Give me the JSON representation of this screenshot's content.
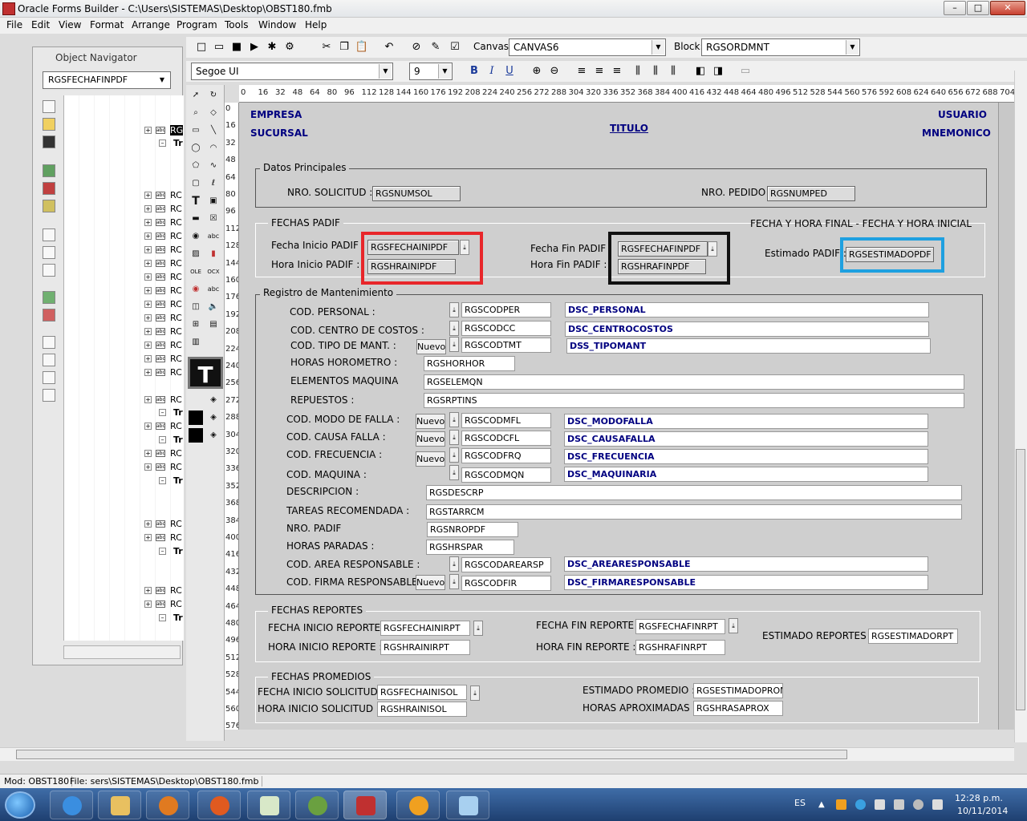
{
  "window": {
    "title": "Oracle Forms Builder - C:\\Users\\SISTEMAS\\Desktop\\OBST180.fmb",
    "min": "–",
    "max": "□",
    "close": "✕"
  },
  "menu": [
    "File",
    "Edit",
    "View",
    "Format",
    "Arrange",
    "Program",
    "Tools",
    "Window",
    "Help"
  ],
  "navigator": {
    "title": "Object Navigator",
    "selected": "RGSFECHAFINPDF",
    "items": [
      "RG",
      "Tr",
      "RC",
      "RC",
      "RC",
      "RC",
      "RC",
      "RC",
      "RC",
      "RC",
      "RC",
      "RC",
      "RC",
      "RC",
      "RC",
      "RC",
      "RC",
      "Tr",
      "RC",
      "Tr",
      "RC",
      "RC",
      "Tr",
      "RC",
      "RC",
      "Tr",
      "RC",
      "RC",
      "Tr"
    ]
  },
  "toolbar": {
    "canvas_label": "Canvas:",
    "canvas_value": "CANVAS6",
    "block_label": "Block:",
    "block_value": "RGSORDMNT",
    "font_value": "Segoe UI",
    "size_value": "9",
    "bold": "B",
    "italic": "I",
    "underline": "U"
  },
  "ruler": {
    "h": [
      "0",
      "16",
      "32",
      "48",
      "64",
      "80",
      "96",
      "112",
      "128",
      "144",
      "160",
      "176",
      "192",
      "208",
      "224",
      "240",
      "256",
      "272",
      "288",
      "304",
      "320",
      "336",
      "352",
      "368",
      "384",
      "400",
      "416",
      "432",
      "448",
      "464",
      "480",
      "496",
      "512",
      "528",
      "544",
      "560",
      "576",
      "592",
      "608",
      "624",
      "640",
      "656",
      "672",
      "688",
      "704"
    ],
    "v": [
      "0",
      "16",
      "32",
      "48",
      "64",
      "80",
      "96",
      "112",
      "128",
      "144",
      "160",
      "176",
      "192",
      "208",
      "224",
      "240",
      "256",
      "272",
      "288",
      "304",
      "320",
      "336",
      "352",
      "368",
      "384",
      "400",
      "416",
      "432",
      "448",
      "464",
      "480",
      "496",
      "512",
      "528",
      "544",
      "560",
      "576"
    ]
  },
  "form": {
    "header": {
      "empresa": "EMPRESA",
      "sucursal": "SUCURSAL",
      "titulo": "TITULO",
      "usuario": "USUARIO",
      "mnemonico": "MNEMONICO"
    },
    "datos": {
      "title": "Datos Principales",
      "solicitud_lbl": "NRO. SOLICITUD :",
      "solicitud": "RGSNUMSOL",
      "pedido_lbl": "NRO. PEDIDO",
      "pedido": "RGSNUMPED"
    },
    "padif": {
      "title": "FECHAS PADIF",
      "fi_lbl": "Fecha Inicio PADIF :",
      "fi": "RGSFECHAINIPDF",
      "hi_lbl": "Hora Inicio PADIF :",
      "hi": "RGSHRAINIPDF",
      "ff_lbl": "Fecha Fin PADIF :",
      "ff": "RGSFECHAFINPDF",
      "hf_lbl": "Hora Fin PADIF :",
      "hf": "RGSHRAFINPDF",
      "note": "FECHA Y HORA FINAL - FECHA Y HORA INICIAL",
      "est_lbl": "Estimado PADIF :",
      "est": "RGSESTIMADOPDF"
    },
    "mant": {
      "title": "Registro de Mantenimiento",
      "nuevo": "Nuevo",
      "personal_lbl": "COD. PERSONAL :",
      "personal": "RGSCODPER",
      "dsc_personal": "DSC_PERSONAL",
      "cc_lbl": "COD. CENTRO DE COSTOS :",
      "cc": "RGSCODCC",
      "dsc_cc": "DSC_CENTROCOSTOS",
      "tm_lbl": "COD. TIPO DE MANT. :",
      "tm": "RGSCODTMT",
      "dsc_tm": "DSS_TIPOMANT",
      "horo_lbl": "HORAS HOROMETRO :",
      "horo": "RGSHORHOR",
      "elem_lbl": "ELEMENTOS MAQUINA",
      "elem": "RGSELEMQN",
      "rep_lbl": "REPUESTOS :",
      "rep": "RGSRPTINS",
      "mf_lbl": "COD. MODO DE FALLA :",
      "mf": "RGSCODMFL",
      "dsc_mf": "DSC_MODOFALLA",
      "cf_lbl": "COD. CAUSA FALLA :",
      "cf": "RGSCODCFL",
      "dsc_cf": "DSC_CAUSAFALLA",
      "fr_lbl": "COD. FRECUENCIA :",
      "fr": "RGSCODFRQ",
      "dsc_fr": "DSC_FRECUENCIA",
      "mq_lbl": "COD. MAQUINA :",
      "mq": "RGSCODMQN",
      "dsc_mq": "DSC_MAQUINARIA",
      "desc_lbl": "DESCRIPCION :",
      "desc": "RGSDESCRP",
      "tar_lbl": "TAREAS RECOMENDADA :",
      "tar": "RGSTARRCM",
      "npadif_lbl": "NRO. PADIF",
      "npadif": "RGSNROPDF",
      "hp_lbl": "HORAS PARADAS :",
      "hp": "RGSHRSPAR",
      "ar_lbl": "COD. AREA RESPONSABLE :",
      "ar": "RGSCODAREARSP",
      "dsc_ar": "DSC_AREARESPONSABLE",
      "fir_lbl": "COD. FIRMA RESPONSABLE",
      "fir": "RGSCODFIR",
      "dsc_fir": "DSC_FIRMARESPONSABLE"
    },
    "rep": {
      "title": "FECHAS REPORTES",
      "fi_lbl": "FECHA INICIO REPORTE :",
      "fi": "RGSFECHAINIRPT",
      "hi_lbl": "HORA INICIO REPORTE :",
      "hi": "RGSHRAINIRPT",
      "ff_lbl": "FECHA FIN REPORTE :",
      "ff": "RGSFECHAFINRPT",
      "hf_lbl": "HORA FIN REPORTE :",
      "hf": "RGSHRAFINRPT",
      "est_lbl": "ESTIMADO REPORTES :",
      "est": "RGSESTIMADORPT"
    },
    "prom": {
      "title": "FECHAS PROMEDIOS",
      "fi_lbl": "FECHA INICIO SOLICITUD :",
      "fi": "RGSFECHAINISOL",
      "hi_lbl": "HORA INICIO SOLICITUD :",
      "hi": "RGSHRAINISOL",
      "est_lbl": "ESTIMADO PROMEDIO :",
      "est": "RGSESTIMADOPROM",
      "ha_lbl": "HORAS APROXIMADAS :",
      "ha": "RGSHRASAPROX"
    }
  },
  "status": {
    "mod": "Mod: OBST180",
    "file": "File: sers\\SISTEMAS\\Desktop\\OBST180.fmb"
  },
  "taskbar": {
    "lang": "ES",
    "time": "12:28 p.m.",
    "date": "10/11/2014"
  },
  "colors": {
    "red": "#e8262a",
    "black": "#111111",
    "blue": "#1ea0e0",
    "dsc": "#000080"
  }
}
